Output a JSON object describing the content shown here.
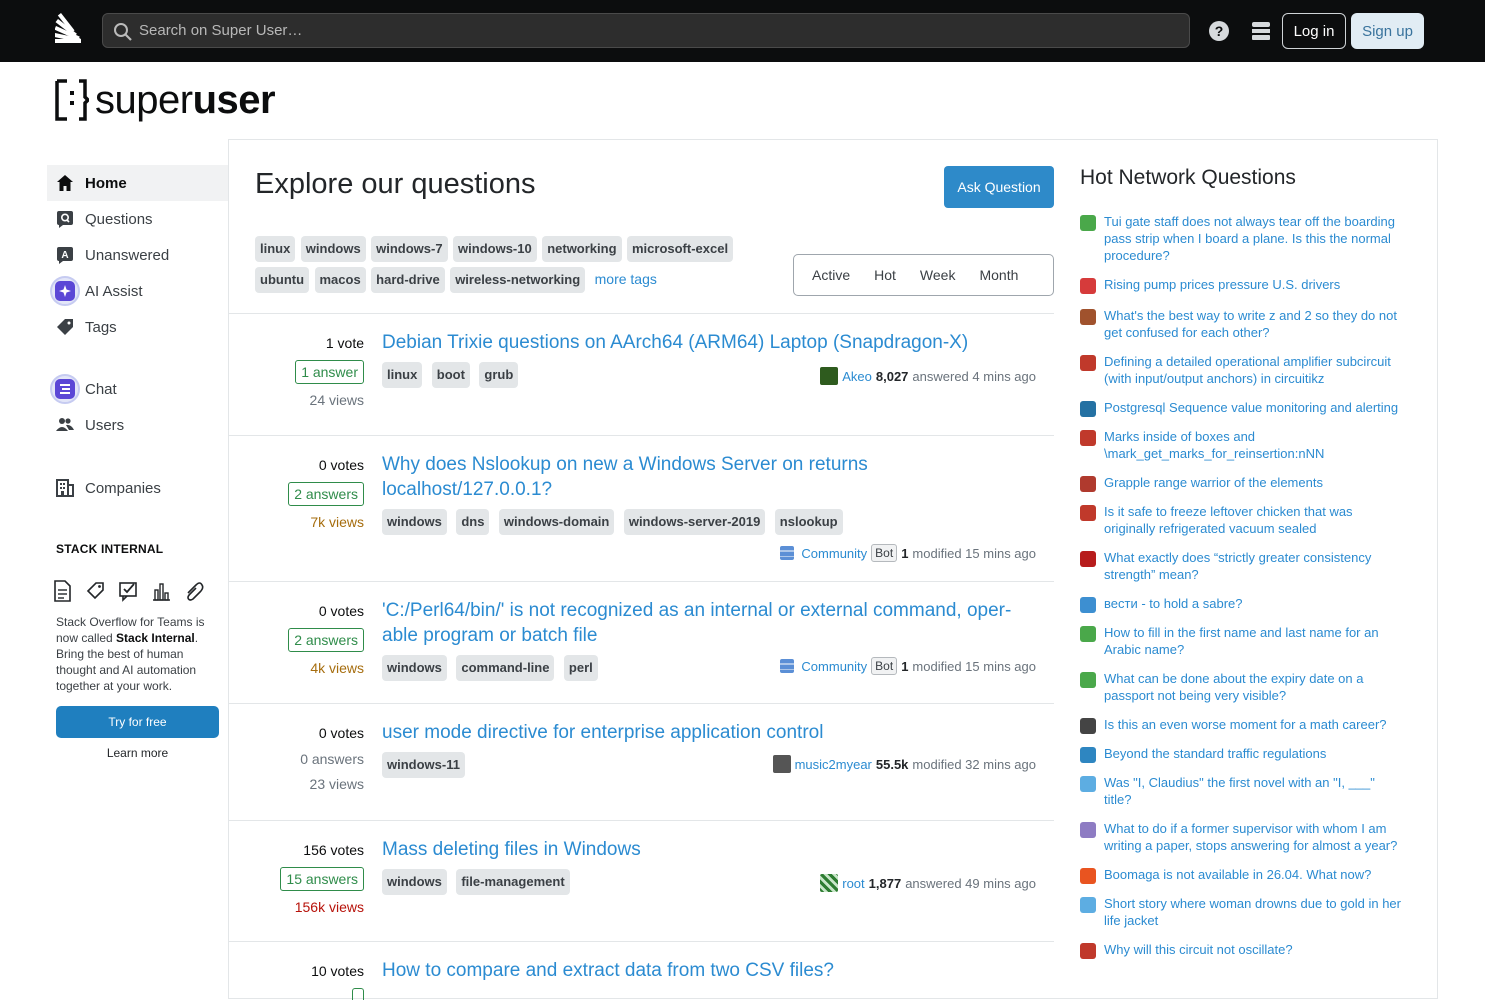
{
  "header": {
    "search_placeholder": "Search on Super User…",
    "login_label": "Log in",
    "signup_label": "Sign up"
  },
  "brand": {
    "text_light": "super",
    "text_bold": "user"
  },
  "sidebar": {
    "items": [
      {
        "label": "Home",
        "icon": "home-icon"
      },
      {
        "label": "Questions",
        "icon": "questions-icon"
      },
      {
        "label": "Unanswered",
        "icon": "unanswered-icon"
      },
      {
        "label": "AI Assist",
        "icon": "ai-assist-icon"
      },
      {
        "label": "Tags",
        "icon": "tag-icon"
      },
      {
        "label": "Chat",
        "icon": "chat-icon"
      },
      {
        "label": "Users",
        "icon": "users-icon"
      },
      {
        "label": "Companies",
        "icon": "companies-icon"
      }
    ],
    "stack_heading": "STACK INTERNAL",
    "stack_desc_pre": "Stack Overflow for Teams is now called ",
    "stack_desc_bold": "Stack Internal",
    "stack_desc_post": ". Bring the best of human thought and AI automation together at your work.",
    "try_label": "Try for free",
    "learn_label": "Learn more"
  },
  "main": {
    "title": "Explore our questions",
    "ask_label": "Ask Question",
    "tags_row1": [
      "linux",
      "windows",
      "windows-7",
      "windows-10",
      "networking",
      "microsoft-excel"
    ],
    "tags_row2": [
      "ubuntu",
      "macos",
      "hard-drive",
      "wireless-networking"
    ],
    "more_tags": "more tags",
    "filters": [
      "Active",
      "Hot",
      "Week",
      "Month"
    ]
  },
  "questions": [
    {
      "votes": "1 vote",
      "answers": "1 answer",
      "views": "24 views",
      "title": "Debian Trixie questions on AArch64 (ARM64) Laptop (Snapdragon-X)",
      "tags": [
        "linux",
        "boot",
        "grub"
      ],
      "user": "Akeo",
      "rep": "8,027",
      "action": "answered 4 mins ago"
    },
    {
      "votes": "0 votes",
      "answers": "2 answers",
      "views": "7k views",
      "title": "Why does Nslookup on new a Windows Server on returns localhost/127.0.0.1?",
      "tags": [
        "windows",
        "dns",
        "windows-domain",
        "windows-server-2019",
        "nslookup"
      ],
      "user": "Community",
      "bot": "Bot",
      "rep": "1",
      "action": "modified 15 mins ago"
    },
    {
      "votes": "0 votes",
      "answers": "2 answers",
      "views": "4k views",
      "title": "'C:/Perl64/bin/' is not recognized as an internal or external command, oper­able program or batch file",
      "tags": [
        "windows",
        "command-line",
        "perl"
      ],
      "user": "Community",
      "bot": "Bot",
      "rep": "1",
      "action": "modified 15 mins ago"
    },
    {
      "votes": "0 votes",
      "answers": "0 answers",
      "views": "23 views",
      "title": "user mode directive for enterprise application control",
      "tags": [
        "windows-11"
      ],
      "user": "music2myear",
      "rep": "55.5k",
      "action": "modified 32 mins ago"
    },
    {
      "votes": "156 votes",
      "answers": "15 answers",
      "views": "156k views",
      "title": "Mass deleting files in Windows",
      "tags": [
        "windows",
        "file-management"
      ],
      "user": "root",
      "rep": "1,877",
      "action": "answered 49 mins ago"
    },
    {
      "votes": "10 votes",
      "answers": "",
      "views": "",
      "title": "How to compare and extract data from two CSV files?",
      "tags": [],
      "user": "",
      "rep": "",
      "action": ""
    }
  ],
  "hot": {
    "title": "Hot Network Questions",
    "items": [
      {
        "text": "Tui gate staff does not always tear off the boarding pass strip when I board a plane. Is this the normal procedure?",
        "icon": "travel-icon",
        "color": "#4aa84a"
      },
      {
        "text": "Rising pump prices pressure U.S. drivers",
        "icon": "politics-icon",
        "color": "#d63b3b"
      },
      {
        "text": "What's the best way to write z and 2 so they do not get confused for each other?",
        "icon": "writing-icon",
        "color": "#a0522d"
      },
      {
        "text": "Defining a detailed operational amplifier subcircuit (with input/output anchors) in circuitikz",
        "icon": "tex-icon",
        "color": "#c0392b"
      },
      {
        "text": "Postgresql Sequence value monitoring and alerting",
        "icon": "dba-icon",
        "color": "#2471a3"
      },
      {
        "text": "Marks inside of boxes and \\mark_get_marks_for_reinsertion:nNN",
        "icon": "tex-icon",
        "color": "#c0392b"
      },
      {
        "text": "Grapple range warrior of the elements",
        "icon": "rpg-icon",
        "color": "#b03a2e"
      },
      {
        "text": "Is it safe to freeze leftover chicken that was originally refrigerated vacuum sealed",
        "icon": "cooking-icon",
        "color": "#c0392b"
      },
      {
        "text": "What exactly does “strictly greater consistency strength” mean?",
        "icon": "math-icon",
        "color": "#b71c1c"
      },
      {
        "text": "вести - to hold a sabre?",
        "icon": "russian-icon",
        "color": "#3d8fd1"
      },
      {
        "text": "How to fill in the first name and last name for an Arabic name?",
        "icon": "travel-icon",
        "color": "#4aa84a"
      },
      {
        "text": "What can be done about the expiry date on a passport not being very visible?",
        "icon": "travel-icon",
        "color": "#4aa84a"
      },
      {
        "text": "Is this an even worse moment for a math career?",
        "icon": "mathoverflow-icon",
        "color": "#444"
      },
      {
        "text": "Beyond the standard traffic regulations",
        "icon": "puzzling-icon",
        "color": "#2e86c1"
      },
      {
        "text": "Was \"I, Claudius\" the first novel with an \"I, ___\" title?",
        "icon": "literature-icon",
        "color": "#5dade2"
      },
      {
        "text": "What to do if a former supervisor with whom I am writing a paper, stops answering for almost a year?",
        "icon": "academia-icon",
        "color": "#8e7cc3"
      },
      {
        "text": "Boomaga is not available in 26.04. What now?",
        "icon": "askubuntu-icon",
        "color": "#e95420"
      },
      {
        "text": "Short story where woman drowns due to gold in her life jacket",
        "icon": "scifi-icon",
        "color": "#5dade2"
      },
      {
        "text": "Why will this circuit not oscillate?",
        "icon": "electronics-icon",
        "color": "#c0392b"
      }
    ]
  }
}
